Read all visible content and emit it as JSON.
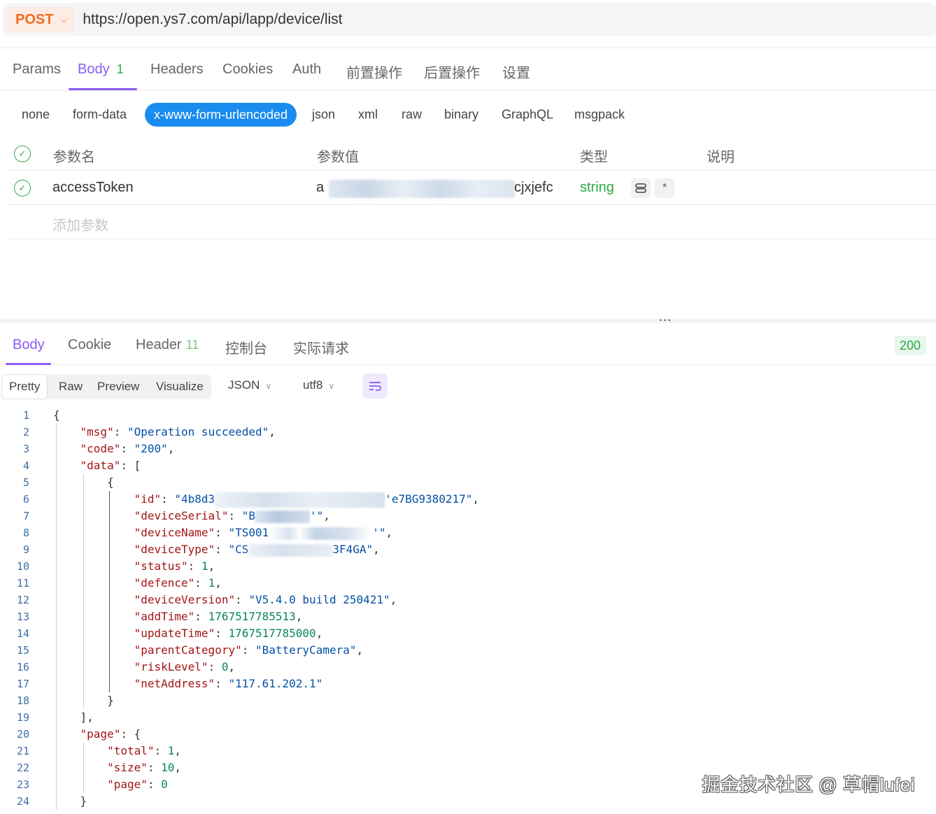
{
  "request": {
    "method": "POST",
    "url": "https://open.ys7.com/api/lapp/device/list"
  },
  "request_tabs": [
    {
      "label": "Params"
    },
    {
      "label": "Body",
      "badge": "1"
    },
    {
      "label": "Headers"
    },
    {
      "label": "Cookies"
    },
    {
      "label": "Auth"
    },
    {
      "label": "前置操作"
    },
    {
      "label": "后置操作"
    },
    {
      "label": "设置"
    }
  ],
  "body_types": [
    "none",
    "form-data",
    "x-www-form-urlencoded",
    "json",
    "xml",
    "raw",
    "binary",
    "GraphQL",
    "msgpack"
  ],
  "params_table": {
    "headers": {
      "name": "参数名",
      "value": "参数值",
      "type": "类型",
      "desc": "说明"
    },
    "rows": [
      {
        "name": "accessToken",
        "value_prefix": "a",
        "value_suffix": "cjxjefc",
        "type": "string",
        "required": "*"
      }
    ],
    "add_placeholder": "添加参数"
  },
  "response_tabs": [
    {
      "label": "Body"
    },
    {
      "label": "Cookie"
    },
    {
      "label": "Header",
      "count": "11"
    },
    {
      "label": "控制台"
    },
    {
      "label": "实际请求"
    }
  ],
  "status_code": "200",
  "view_modes": [
    "Pretty",
    "Raw",
    "Preview",
    "Visualize"
  ],
  "format_select": "JSON",
  "encoding_select": "utf8",
  "code": {
    "line_numbers": [
      "1",
      "2",
      "3",
      "4",
      "5",
      "6",
      "7",
      "8",
      "9",
      "10",
      "11",
      "12",
      "13",
      "14",
      "15",
      "16",
      "17",
      "18",
      "19",
      "20",
      "21",
      "22",
      "23",
      "24"
    ],
    "msg": "\"Operation succeeded\"",
    "code_val": "\"200\"",
    "id_prefix": "\"4b8d3",
    "id_suffix": "'e7BG9380217\"",
    "serial_prefix": "\"B",
    "serial_suffix": "'\"",
    "name_prefix": "\"TS001",
    "name_suffix": "'\"",
    "type_prefix": "\"CS",
    "type_suffix": "3F4GA\"",
    "status": "1",
    "defence": "1",
    "deviceVersion": "\"V5.4.0 build 250421\"",
    "addTime": "1767517785513",
    "updateTime": "1767517785000",
    "parentCategory": "\"BatteryCamera\"",
    "riskLevel": "0",
    "netAddress": "\"117.61.202.1\"",
    "page_total": "1",
    "page_size": "10",
    "page_page": "0"
  },
  "watermark": "掘金技术社区 @ 草帽lufei",
  "colors": {
    "accent": "#8b5cf6",
    "method": "#f26b21",
    "pill": "#1a8cf0",
    "success": "#2aa84a"
  }
}
